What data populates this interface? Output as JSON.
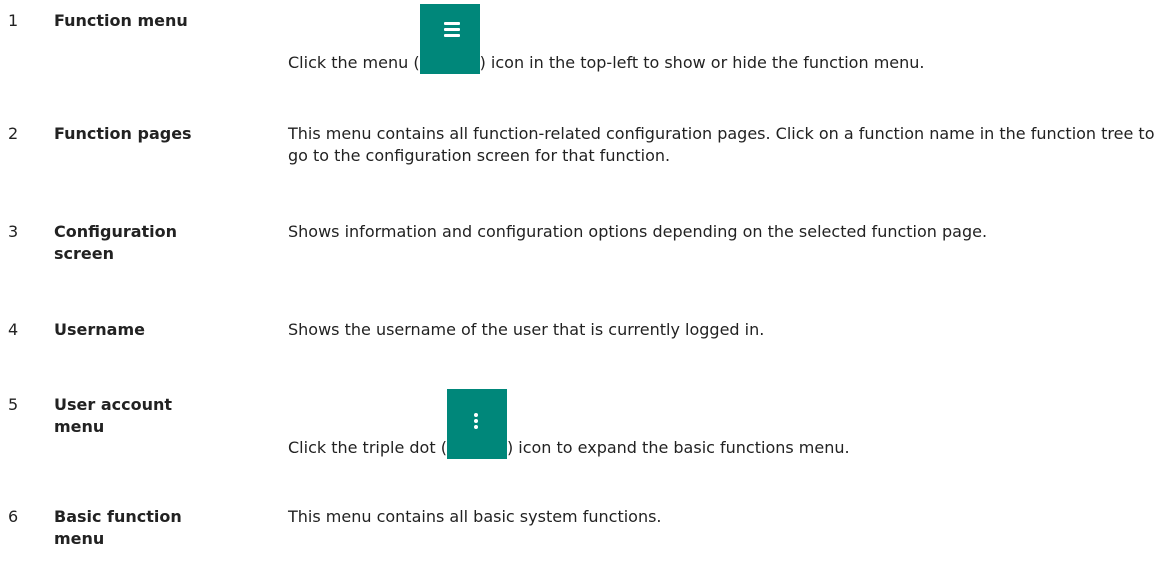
{
  "items": [
    {
      "number": "1",
      "term": "Function menu",
      "desc_before": "Click the menu (",
      "icon": "hamburger-menu-icon",
      "desc_after": ") icon in the top-left to show or hide the function menu."
    },
    {
      "number": "2",
      "term": "Function pages",
      "desc": "This menu contains all function-related configuration pages. Click on a function name in the function tree to go to the configuration screen for that function."
    },
    {
      "number": "3",
      "term": "Configuration screen",
      "desc": "Shows information and configuration options depending on the selected function page."
    },
    {
      "number": "4",
      "term": "Username",
      "desc": "Shows the username of the user that is currently logged in."
    },
    {
      "number": "5",
      "term": "User account menu",
      "desc_before": "Click the triple dot (",
      "icon": "triple-dot-icon",
      "desc_after": ") icon to expand the basic functions menu."
    },
    {
      "number": "6",
      "term": "Basic function menu",
      "desc": "This menu contains all basic system functions."
    }
  ],
  "colors": {
    "icon_background": "#00877a",
    "icon_foreground": "#ffffff"
  }
}
